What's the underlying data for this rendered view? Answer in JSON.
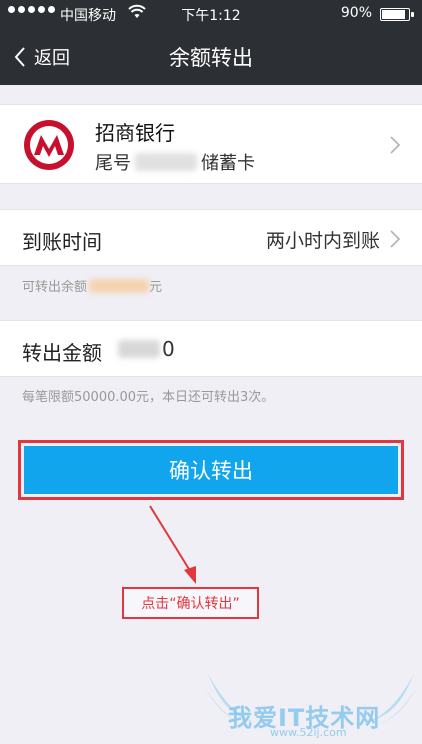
{
  "status": {
    "carrier": "中国移动",
    "time": "下午1:12",
    "battery": "90%",
    "battery_level": 0.9,
    "signal_dots": 5
  },
  "nav": {
    "back_label": "返回",
    "title": "余额转出"
  },
  "bank": {
    "name": "招商银行",
    "account_prefix": "尾号",
    "account_suffix": "储蓄卡"
  },
  "arrival": {
    "label": "到账时间",
    "value": "两小时内到账"
  },
  "available": {
    "prefix": "可转出余额",
    "suffix": "元"
  },
  "amount": {
    "label": "转出金额",
    "tail": "0"
  },
  "limit_text": "每笔限额50000.00元，本日还可转出3次。",
  "confirm_label": "确认转出",
  "annotation": "点击“确认转出”",
  "watermark": {
    "text": "我爱IT技术网",
    "url": "www.52ij.com"
  },
  "colors": {
    "nav_bg": "#2c2f33",
    "confirm_bg": "#10a5ec",
    "annotation_red": "#e0383e",
    "page_bg": "#f0eff5"
  }
}
